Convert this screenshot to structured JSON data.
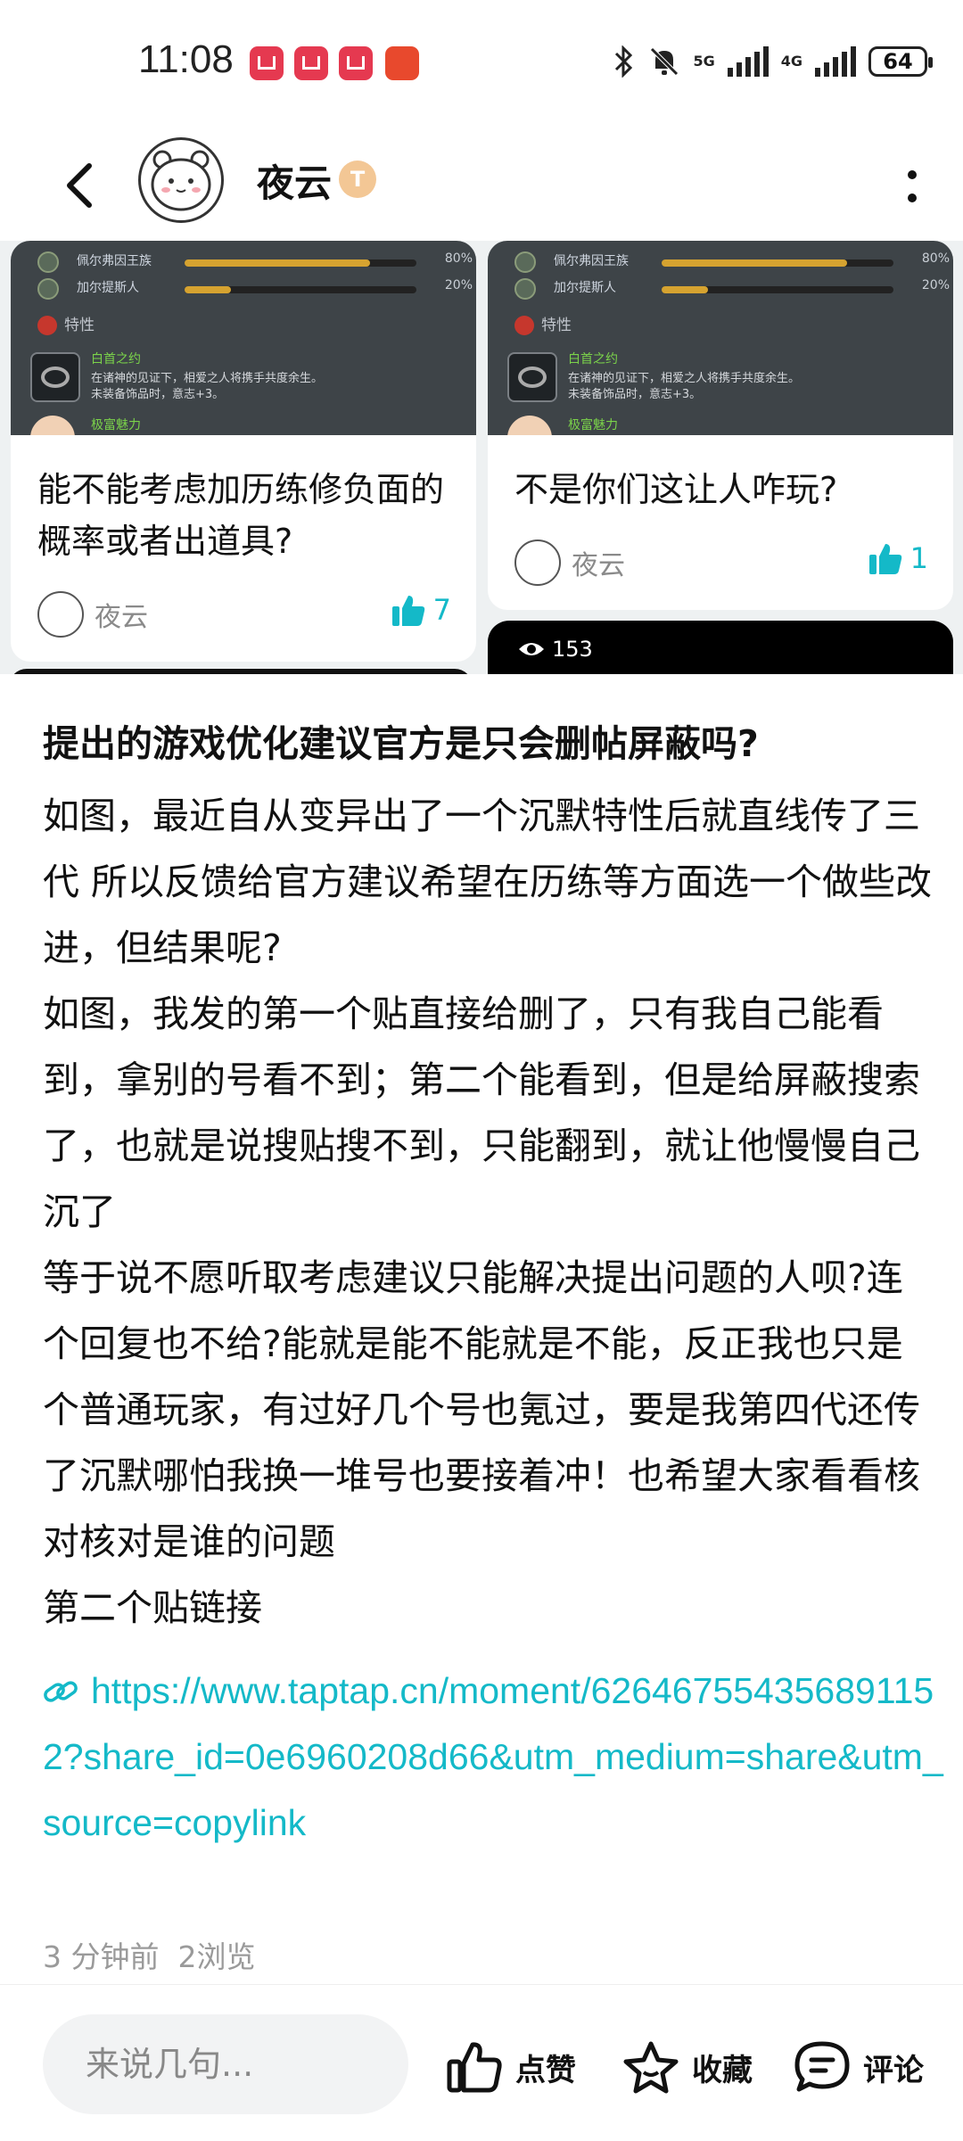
{
  "status_bar": {
    "time": "11:08",
    "signal_1": "5G",
    "signal_2": "4G",
    "battery": "64"
  },
  "header": {
    "author_name": "夜云",
    "badge": "T",
    "back_icon": "chevron-left-icon",
    "more_icon": "vertical-ellipsis-icon"
  },
  "cards": [
    {
      "image": {
        "bar_1_name": "佩尔弗因王族",
        "bar_1_pct": "80%",
        "bar_1_fill": 0.8,
        "bar_2_name": "加尔提斯人",
        "bar_2_pct": "20%",
        "bar_2_fill": 0.2,
        "trait_title": "特性",
        "ring_name": "白首之约",
        "ring_desc_1": "在诸神的见证下，相爱之人将携手共度余生。",
        "ring_desc_2": "未装备饰品时，意志+3。",
        "trait_2": "极富魅力"
      },
      "title": "能不能考虑加历练修负面的概率或者出道具?",
      "author": "夜云",
      "likes": "7"
    },
    {
      "image": {
        "bar_1_name": "佩尔弗因王族",
        "bar_1_pct": "80%",
        "bar_1_fill": 0.8,
        "bar_2_name": "加尔提斯人",
        "bar_2_pct": "20%",
        "bar_2_fill": 0.2,
        "trait_title": "特性",
        "ring_name": "白首之约",
        "ring_desc_1": "在诸神的见证下，相爱之人将携手共度余生。",
        "ring_desc_2": "未装备饰品时，意志+3。",
        "trait_2": "极富魅力"
      },
      "title": "不是你们这让人咋玩?",
      "author": "夜云",
      "likes": "1"
    }
  ],
  "video_card": {
    "views": "153"
  },
  "post": {
    "title": "提出的游戏优化建议官方是只会删帖屏蔽吗?",
    "paragraphs": [
      "如图，最近自从变异出了一个沉默特性后就直线传了三代 所以反馈给官方建议希望在历练等方面选一个做些改进，但结果呢?",
      "如图，我发的第一个贴直接给删了，只有我自己能看到，拿别的号看不到；第二个能看到，但是给屏蔽搜索了，也就是说搜贴搜不到，只能翻到，就让他慢慢自己沉了",
      "等于说不愿听取考虑建议只能解决提出问题的人呗?连个回复也不给?能就是能不能就是不能，反正我也只是个普通玩家，有过好几个号也氪过，要是我第四代还传了沉默哪怕我换一堆号也要接着冲！也希望大家看看核对核对是谁的问题",
      "第二个贴链接"
    ],
    "link": "https://www.taptap.cn/moment/626467554356891152?share_id=0e6960208d66&utm_medium=share&utm_source=copylink",
    "time": "3 分钟前",
    "views": "2浏览"
  },
  "bottom_bar": {
    "comment_placeholder": "来说几句...",
    "like_label": "点赞",
    "favorite_label": "收藏",
    "comment_label": "评论"
  },
  "colors": {
    "accent": "#14b9c8",
    "badge": "#f3c795"
  }
}
